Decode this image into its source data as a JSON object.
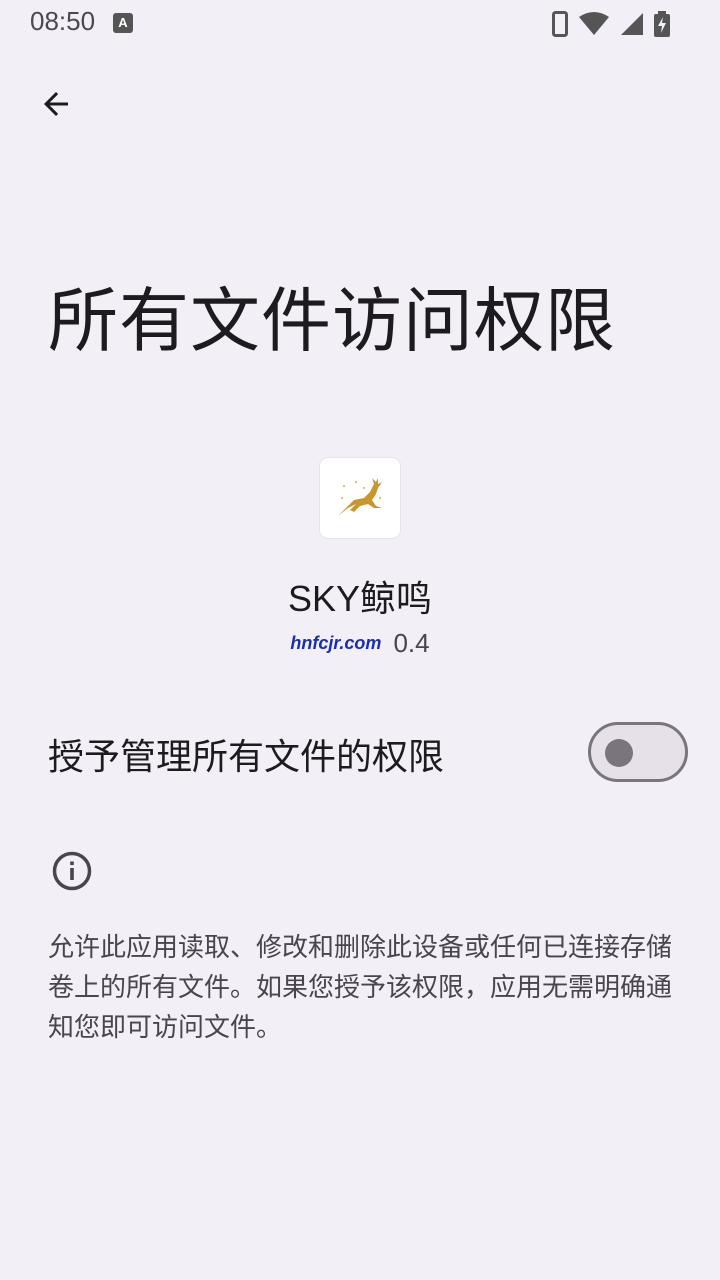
{
  "status_bar": {
    "time": "08:50",
    "notification_icon": "A",
    "icons": [
      "phone-icon",
      "wifi-icon",
      "signal-icon",
      "battery-charging-icon"
    ]
  },
  "header": {
    "back_icon": "arrow-back-icon"
  },
  "page": {
    "title": "所有文件访问权限"
  },
  "app": {
    "name": "SKY鲸鸣",
    "watermark": "hnfcjr.com",
    "version": "0.4",
    "icon": "deer-icon"
  },
  "permission": {
    "toggle_label": "授予管理所有文件的权限",
    "enabled": false
  },
  "info": {
    "icon": "info-icon",
    "description": "允许此应用读取、修改和删除此设备或任何已连接存储卷上的所有文件。如果您授予该权限，应用无需明确通知您即可访问文件。"
  },
  "colors": {
    "background": "#f3eff6",
    "text_primary": "#1d1b20",
    "text_secondary": "#49454f",
    "switch_outline": "#79747e",
    "watermark": "#1a2fb0"
  }
}
